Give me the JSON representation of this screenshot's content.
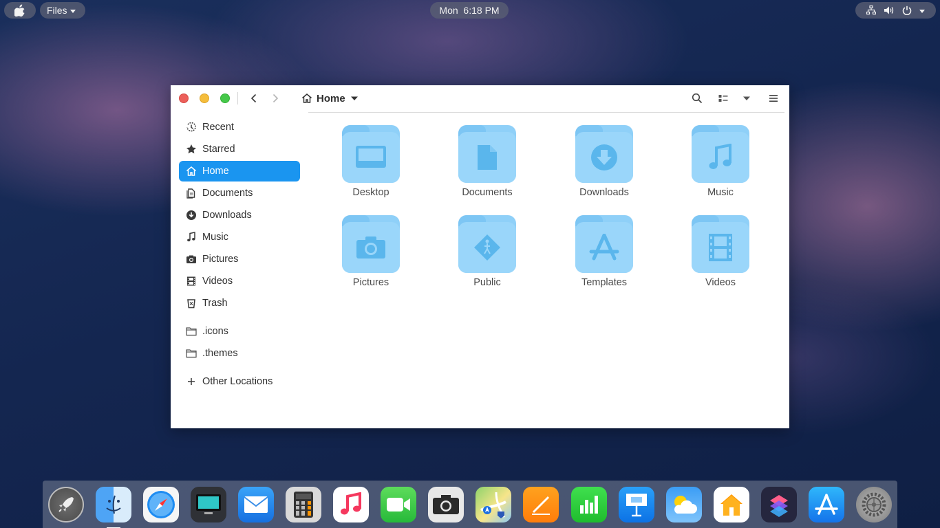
{
  "top_panel": {
    "app_menu_label": "Files",
    "clock": "Mon  6:18 PM"
  },
  "window": {
    "path_label": "Home"
  },
  "sidebar": {
    "items": [
      {
        "label": "Recent",
        "icon": "clock-icon"
      },
      {
        "label": "Starred",
        "icon": "star-icon"
      },
      {
        "label": "Home",
        "icon": "home-icon",
        "active": true
      },
      {
        "label": "Documents",
        "icon": "document-icon"
      },
      {
        "label": "Downloads",
        "icon": "download-icon"
      },
      {
        "label": "Music",
        "icon": "music-note-icon"
      },
      {
        "label": "Pictures",
        "icon": "camera-icon"
      },
      {
        "label": "Videos",
        "icon": "film-icon"
      },
      {
        "label": "Trash",
        "icon": "trash-icon"
      }
    ],
    "bookmarks": [
      {
        "label": ".icons",
        "icon": "folder-icon"
      },
      {
        "label": ".themes",
        "icon": "folder-icon"
      }
    ],
    "other_locations_label": "Other Locations"
  },
  "files": [
    {
      "label": "Desktop",
      "icon": "desktop-folder-icon"
    },
    {
      "label": "Documents",
      "icon": "documents-folder-icon"
    },
    {
      "label": "Downloads",
      "icon": "downloads-folder-icon"
    },
    {
      "label": "Music",
      "icon": "music-folder-icon"
    },
    {
      "label": "Pictures",
      "icon": "pictures-folder-icon"
    },
    {
      "label": "Public",
      "icon": "public-folder-icon"
    },
    {
      "label": "Templates",
      "icon": "templates-folder-icon"
    },
    {
      "label": "Videos",
      "icon": "videos-folder-icon"
    }
  ],
  "dock": [
    "launchpad-icon",
    "finder-icon",
    "safari-icon",
    "screen-icon",
    "mail-icon",
    "calculator-icon",
    "music-icon",
    "facetime-icon",
    "camera-icon",
    "maps-icon",
    "pages-icon",
    "numbers-icon",
    "keynote-icon",
    "weather-icon",
    "home-app-icon",
    "shortcuts-icon",
    "app-store-icon",
    "settings-icon"
  ],
  "colors": {
    "accent": "#1a95f0",
    "folder": "#9ad6fa",
    "folder_glyph": "#58b4ec"
  }
}
